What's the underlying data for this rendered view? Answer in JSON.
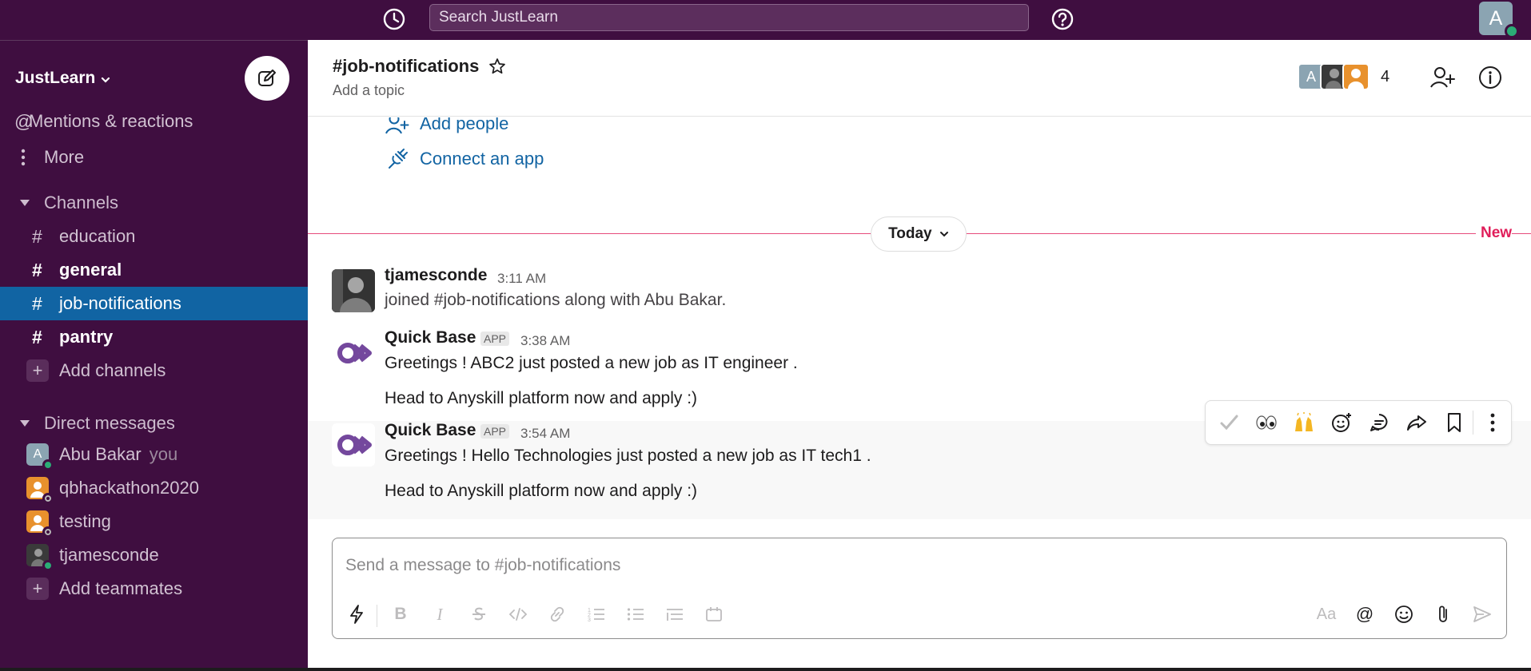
{
  "topbar": {
    "search_placeholder": "Search JustLearn",
    "user_initial": "A"
  },
  "sidebar": {
    "workspace": "JustLearn",
    "nav": [
      {
        "label": "Mentions & reactions"
      },
      {
        "label": "More"
      }
    ],
    "channels_header": "Channels",
    "channels": [
      {
        "name": "education"
      },
      {
        "name": "general"
      },
      {
        "name": "job-notifications"
      },
      {
        "name": "pantry"
      }
    ],
    "add_channels": "Add channels",
    "dm_header": "Direct messages",
    "dms": [
      {
        "name": "Abu Bakar",
        "initial": "A"
      },
      {
        "name": "qbhackathon2020"
      },
      {
        "name": "testing"
      },
      {
        "name": "tjamesconde"
      }
    ],
    "you_label": "you",
    "add_teammates": "Add teammates"
  },
  "channel": {
    "title": "#job-notifications",
    "topic": "Add a topic",
    "member_initial": "A",
    "member_count": "4"
  },
  "intro": {
    "add_people": "Add people",
    "connect_app": "Connect an app"
  },
  "divider": {
    "today": "Today",
    "new": "New"
  },
  "messages": [
    {
      "sender": "tjamesconde",
      "time": "3:11 AM",
      "lines": [
        "joined #job-notifications along with Abu Bakar."
      ]
    },
    {
      "sender": "Quick Base",
      "badge": "APP",
      "time": "3:38 AM",
      "lines": [
        "Greetings ! ABC2 just posted a new job as IT engineer .",
        "Head to Anyskill platform now and apply :)"
      ]
    },
    {
      "sender": "Quick Base",
      "badge": "APP",
      "time": "3:54 AM",
      "lines": [
        "Greetings ! Hello Technologies just posted a new job as IT tech1 .",
        "Head to Anyskill platform now and apply :)"
      ]
    }
  ],
  "composer": {
    "placeholder": "Send a message to #job-notifications",
    "aa": "Aa",
    "bold": "B",
    "italic": "I"
  },
  "colors": {
    "sidebar": "#3f0e40",
    "active": "#1164a3",
    "link": "#1264a3",
    "new_divider": "#e01e5a",
    "online": "#2bac76"
  }
}
